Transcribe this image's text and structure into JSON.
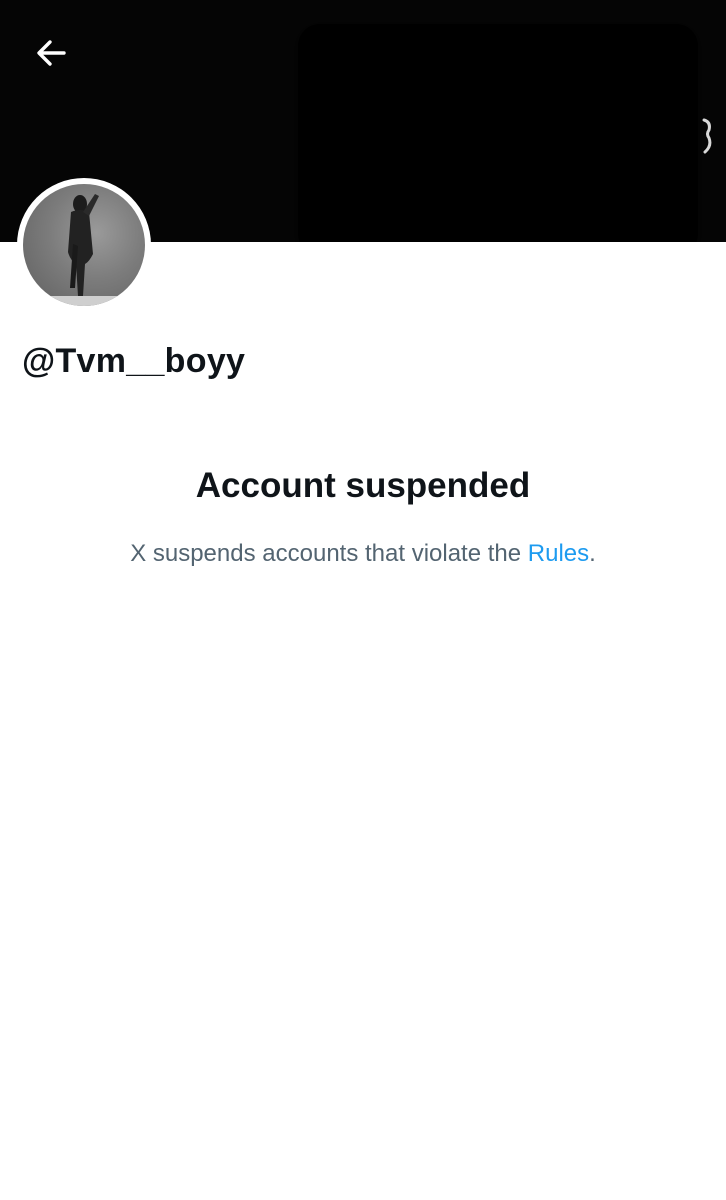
{
  "header": {
    "back_icon": "arrow-left-icon"
  },
  "profile": {
    "handle": "@Tvm__boyy"
  },
  "suspension": {
    "title": "Account suspended",
    "message_prefix": "X suspends accounts that violate the ",
    "rules_link": "Rules",
    "message_suffix": "."
  },
  "colors": {
    "text_primary": "#0f1419",
    "text_secondary": "#536471",
    "link": "#1d9bf0",
    "banner": "#050505"
  }
}
